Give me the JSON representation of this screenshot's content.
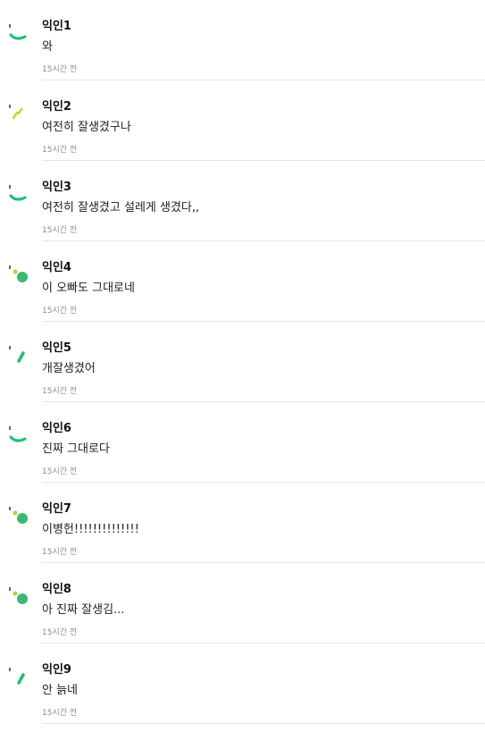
{
  "comments": [
    {
      "name": "익인1",
      "text": "와",
      "time": "15시간 전",
      "avatar_icon": "green-arc-avatar-icon"
    },
    {
      "name": "익인2",
      "text": "여전히 잘생겼구나",
      "time": "15시간 전",
      "avatar_icon": "yellow-dash-avatar-icon"
    },
    {
      "name": "익인3",
      "text": "여전히 잘생겼고 설레게 생겼다,,",
      "time": "15시간 전",
      "avatar_icon": "green-arc-avatar-icon"
    },
    {
      "name": "익인4",
      "text": "이 오빠도 그대로네",
      "time": "15시간 전",
      "avatar_icon": "green-dots-avatar-icon"
    },
    {
      "name": "익인5",
      "text": "개잘생겼어",
      "time": "15시간 전",
      "avatar_icon": "green-slash-avatar-icon"
    },
    {
      "name": "익인6",
      "text": "진짜 그대로다",
      "time": "15시간 전",
      "avatar_icon": "green-arc-avatar-icon"
    },
    {
      "name": "익인7",
      "text": "이병헌!!!!!!!!!!!!!!",
      "time": "15시간 전",
      "avatar_icon": "green-dots-avatar-icon"
    },
    {
      "name": "익인8",
      "text": "아 진짜 잘생김...",
      "time": "15시간 전",
      "avatar_icon": "green-dots-avatar-icon"
    },
    {
      "name": "익인9",
      "text": "안 늙네",
      "time": "15시간 전",
      "avatar_icon": "green-slash-avatar-icon"
    }
  ],
  "colors": {
    "avatar_green": "#1fbf6e",
    "avatar_light_green": "#9fdc3c",
    "avatar_yellow": "#c8d62a",
    "divider": "#e6e6e6",
    "time_text": "#8c8c8c"
  }
}
